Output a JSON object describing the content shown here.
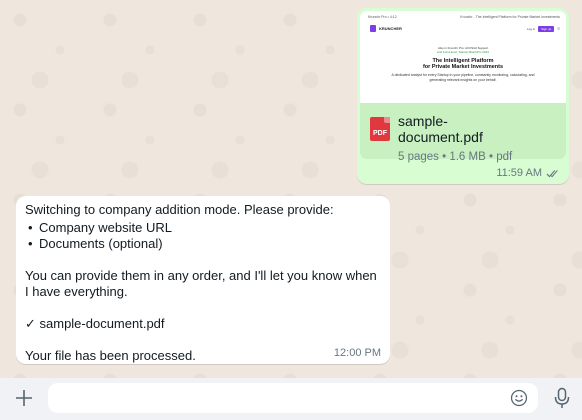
{
  "outgoing": {
    "preview": {
      "topbar_left": "Krunchr Pro • 4:12",
      "topbar_right": "Krunchr - The Intelligent Platform for Private Market Investments",
      "logo_text": "KRUNCHER",
      "nav_links": "Log in",
      "nav_button": "Sign up",
      "small_line_1": "Also in Krunchr Pro: All FS/AI Support",
      "small_line_2": "and Fund-level, Startup BatchPro 2024",
      "headline_1": "The Intelligent Platform",
      "headline_2": "for Private Market Investments",
      "subtext": "A dedicated analyst for every Startup in your pipeline, constantly monitoring, calculating, and generating relevant insights on your behalf."
    },
    "file": {
      "icon_label": "PDF",
      "name": "sample-document.pdf",
      "meta": "5 pages • 1.6 MB • pdf"
    },
    "time": "11:59 AM"
  },
  "incoming": {
    "intro": "Switching to company addition mode. Please provide:",
    "items": [
      "Company website URL",
      "Documents (optional)"
    ],
    "paragraph": "You can provide them in any order, and I'll let you know when I have everything.",
    "received": "✓ sample-document.pdf",
    "processed": "Your file has been processed.",
    "time": "12:00 PM"
  },
  "composer": {
    "placeholder": "",
    "value": ""
  },
  "icons": {
    "plus": "plus-icon",
    "emoji": "emoji-icon",
    "mic": "microphone-icon",
    "ticks": "double-check-icon",
    "pdf": "pdf-file-icon"
  },
  "colors": {
    "chat_background": "#efe7dd",
    "outgoing_bubble": "#d9fdd3",
    "incoming_bubble": "#ffffff",
    "pdf_red": "#e0383e",
    "brand_purple": "#7b3fe4"
  }
}
